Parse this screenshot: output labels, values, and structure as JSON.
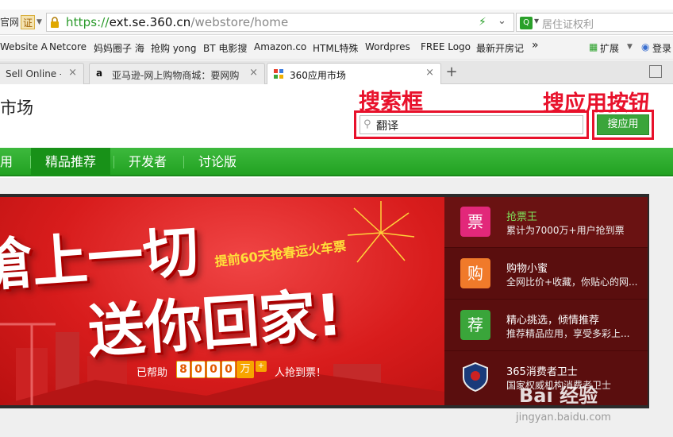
{
  "urlbar": {
    "badge_site": "官网",
    "badge_cert": "证",
    "url_scheme": "https://",
    "url_domain": "ext.se.360.cn",
    "url_path": "/webstore/home",
    "search_placeholder": "居住证权利"
  },
  "bookmarks": {
    "items": [
      "Website A",
      "Netcore",
      "妈妈圈子 海",
      "抢购 yong",
      "BT 电影搜",
      "Amazon.co",
      "HTML特殊",
      "Wordpres",
      "FREE Logo",
      "最新开房记"
    ],
    "more": "»",
    "extensions": "扩展",
    "login": "登录"
  },
  "tabs": [
    {
      "label": "Sell Online -",
      "close": "×"
    },
    {
      "label": "亚马逊-网上购物商城：要网购",
      "close": "×"
    },
    {
      "label": "360应用市场",
      "close": "×"
    }
  ],
  "newtab": "+",
  "site": {
    "title": "市场",
    "annotation_search": "搜索框",
    "annotation_button": "搜应用按钮",
    "search_value": "翻译",
    "search_button": "搜应用"
  },
  "nav": {
    "items": [
      "用",
      "精品推荐",
      "开发者",
      "讨论版"
    ]
  },
  "banner": {
    "headline_1": "搶上一切",
    "headline_2": "送你回家!",
    "slogan": "提前60天抢春运火车票",
    "helped_prefix": "已帮助",
    "digits": [
      "8",
      "0",
      "0",
      "0"
    ],
    "unit": "万",
    "plus": "+",
    "helped_suffix": "人抢到票！"
  },
  "apps": [
    {
      "icon": "票",
      "name": "抢票王",
      "desc": "累计为7000万+用户抢到票",
      "color": "#e2287a"
    },
    {
      "icon": "购",
      "name": "购物小蜜",
      "desc": "全网比价+收藏，你贴心的网...",
      "color": "#f07a2a"
    },
    {
      "icon": "荐",
      "name": "精心挑选，倾情推荐",
      "desc": "推荐精品应用，享受多彩上...",
      "color": "#3aa53a"
    },
    {
      "icon": "",
      "name": "365消费者卫士",
      "desc": "国家权威机构消费者卫士",
      "color": "#1a3a7a"
    }
  ],
  "watermark": {
    "text": "Bai 经验",
    "url": "jingyan.baidu.com"
  }
}
